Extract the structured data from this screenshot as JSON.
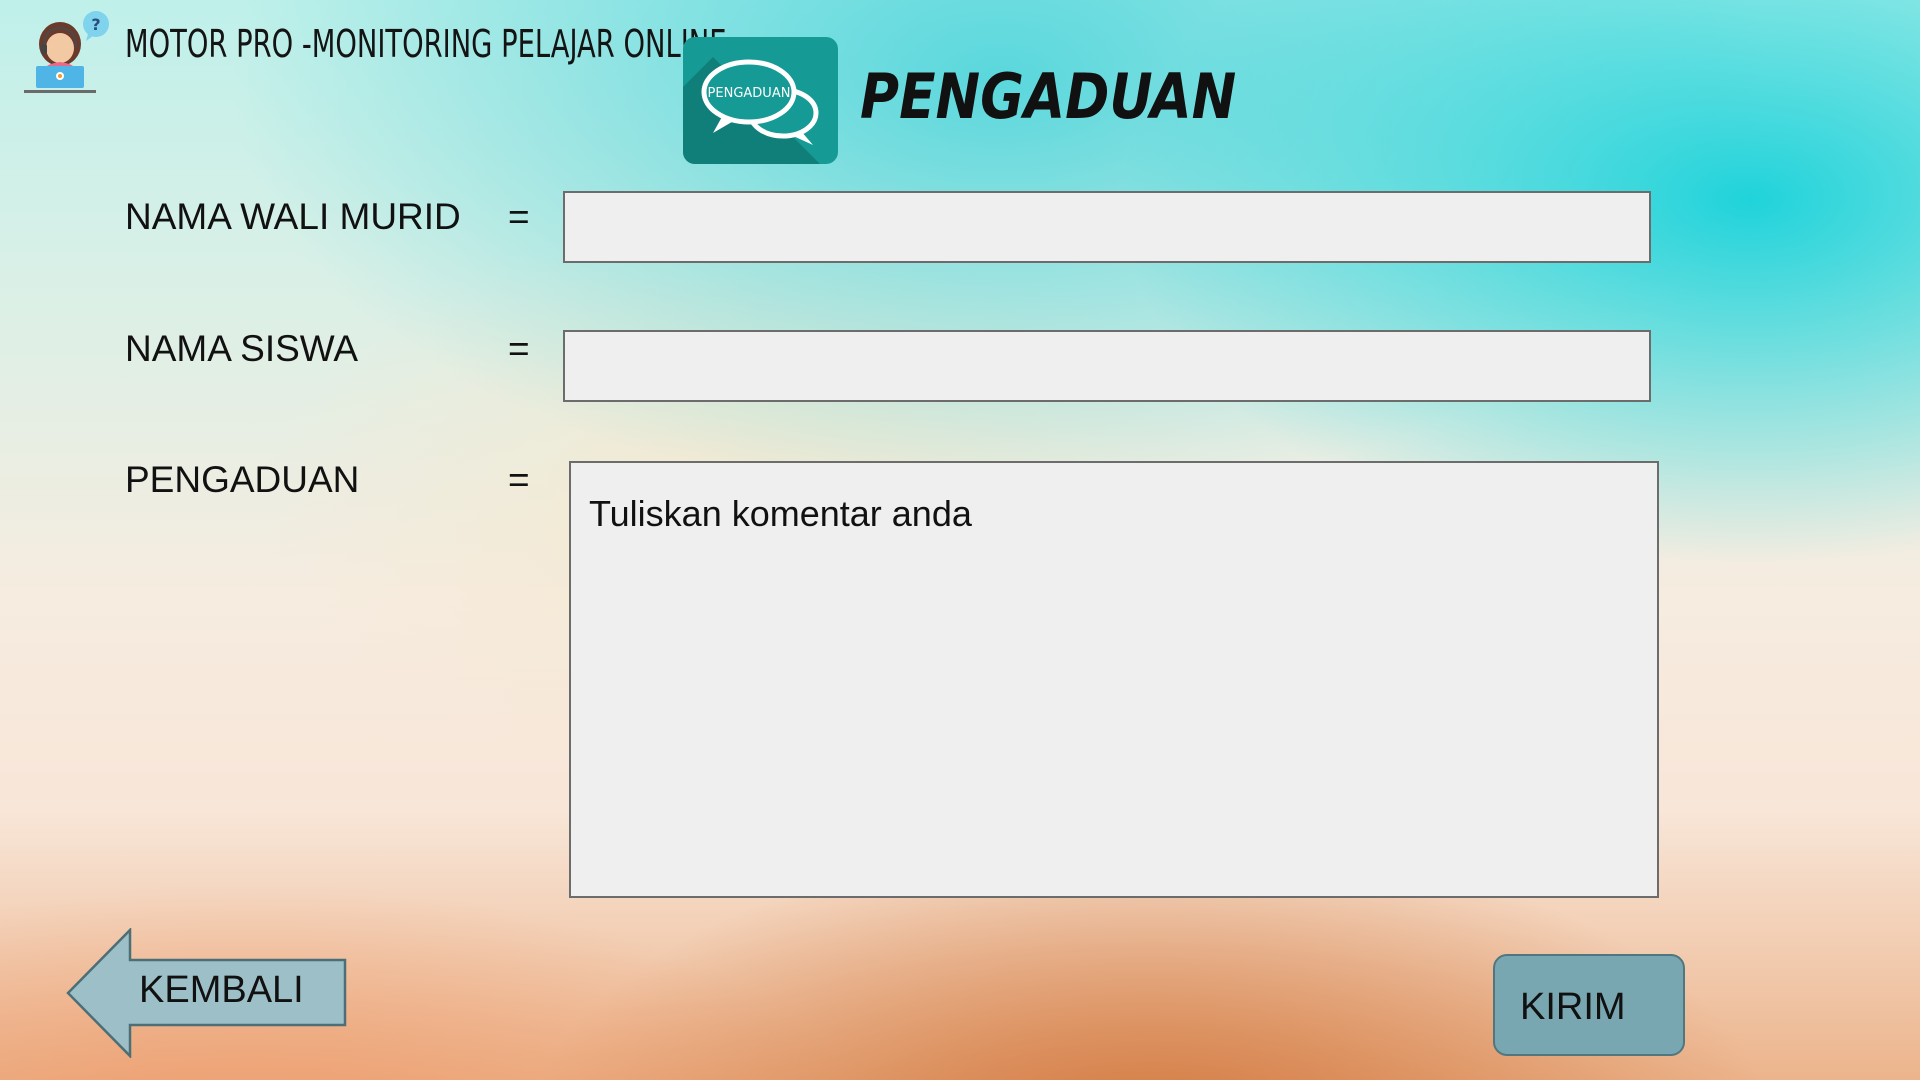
{
  "header": {
    "app_title": "MOTOR PRO -MONITORING PELAJAR ONLINE",
    "page_title": "PENGADUAN",
    "icon_text": "PENGADUAN"
  },
  "form": {
    "guardian_name": {
      "label": "NAMA WALI MURID",
      "separator": "=",
      "value": ""
    },
    "student_name": {
      "label": "NAMA SISWA",
      "separator": "=",
      "value": ""
    },
    "complaint": {
      "label": "PENGADUAN",
      "separator": "=",
      "value": "Tuliskan komentar anda"
    }
  },
  "buttons": {
    "back_label": "KEMBALI",
    "send_label": "KIRIM"
  },
  "colors": {
    "icon_bg": "#169a95",
    "button_bg": "#78a7b2",
    "back_arrow": "#9dc0c8",
    "field_bg": "#efefef"
  }
}
